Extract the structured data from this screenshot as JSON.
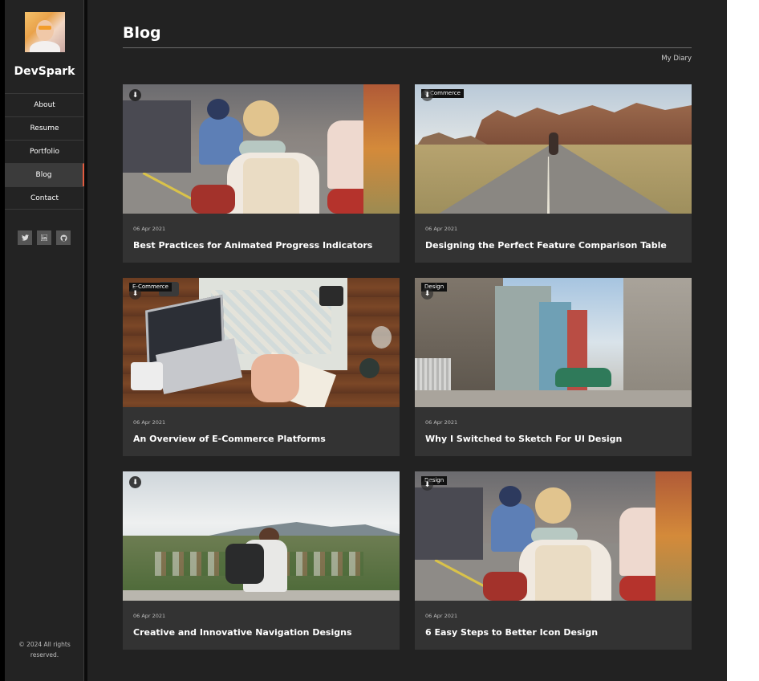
{
  "sidebar": {
    "brand": "DevSpark",
    "nav": [
      "About",
      "Resume",
      "Portfolio",
      "Blog",
      "Contact"
    ],
    "active": "Blog",
    "social": [
      "twitter-icon",
      "linkedin-icon",
      "github-icon"
    ],
    "copyright": "© 2024 All rights reserved."
  },
  "main": {
    "title": "Blog",
    "breadcrumb": "My Diary"
  },
  "posts": [
    {
      "date": "06 Apr 2021",
      "title": "Best Practices for Animated Progress Indicators",
      "tag": ""
    },
    {
      "date": "06 Apr 2021",
      "title": "Designing the Perfect Feature Comparison Table",
      "tag": "E-Commerce"
    },
    {
      "date": "06 Apr 2021",
      "title": "An Overview of E-Commerce Platforms",
      "tag": "E-Commerce"
    },
    {
      "date": "06 Apr 2021",
      "title": "Why I Switched to Sketch For UI Design",
      "tag": "Design"
    },
    {
      "date": "06 Apr 2021",
      "title": "Creative and Innovative Navigation Designs",
      "tag": ""
    },
    {
      "date": "06 Apr 2021",
      "title": "6 Easy Steps to Better Icon Design",
      "tag": "Design"
    }
  ],
  "colors": {
    "accent": "#e25b3f",
    "sidebar_bg": "#232323",
    "main_bg": "#222222",
    "card_bg": "#333333"
  }
}
